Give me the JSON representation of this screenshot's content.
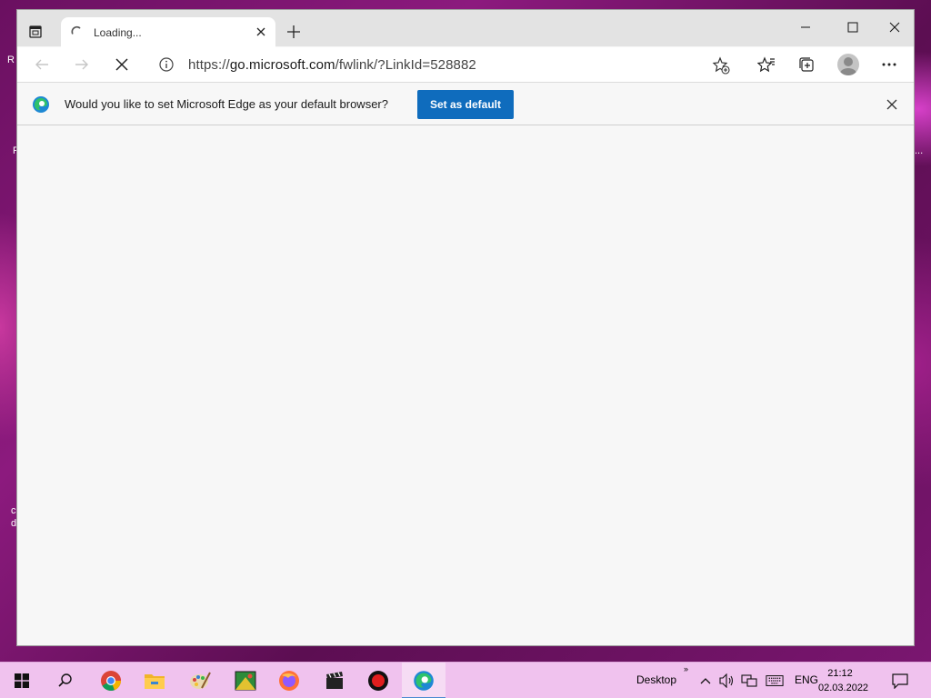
{
  "browser": {
    "tab": {
      "title": "Loading..."
    },
    "address": {
      "prefix": "https://",
      "host": "go.microsoft.com",
      "path": "/fwlink/?LinkId=528882"
    },
    "infobar": {
      "message": "Would you like to set Microsoft Edge as your default browser?",
      "button_label": "Set as default"
    }
  },
  "taskbar": {
    "apps": [
      "windows-start",
      "search",
      "chrome",
      "file-explorer",
      "paint",
      "image-app",
      "firefox",
      "video-editor",
      "recorder",
      "edge"
    ],
    "tray": {
      "desktop_label": "Desktop",
      "chevrons": "»",
      "language": "ENG",
      "time": "21:12",
      "date": "02.03.2022"
    }
  },
  "colors": {
    "accent": "#0f6cbd",
    "taskbar": "#f0c2ee",
    "wallpaper": "#8c1a7e"
  }
}
